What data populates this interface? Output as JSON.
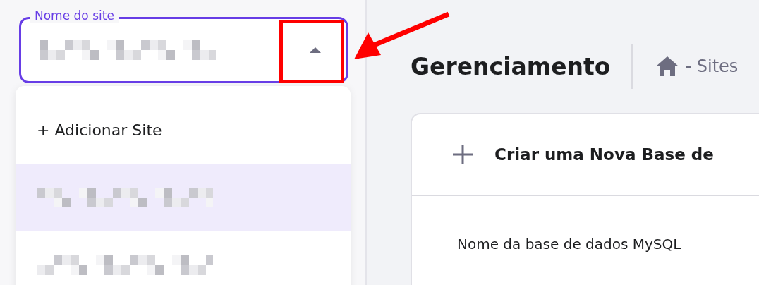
{
  "site_field": {
    "label": "Nome do site",
    "expanded": true
  },
  "options": [
    {
      "kind": "add",
      "label": "+ Adicionar Site",
      "selected": false
    },
    {
      "kind": "site",
      "selected": true
    },
    {
      "kind": "site",
      "selected": false
    }
  ],
  "header": {
    "title": "Gerenciamento",
    "breadcrumb": "- Sites"
  },
  "card": {
    "title": "Criar uma Nova Base de",
    "field_label": "Nome da base de dados MySQL"
  }
}
